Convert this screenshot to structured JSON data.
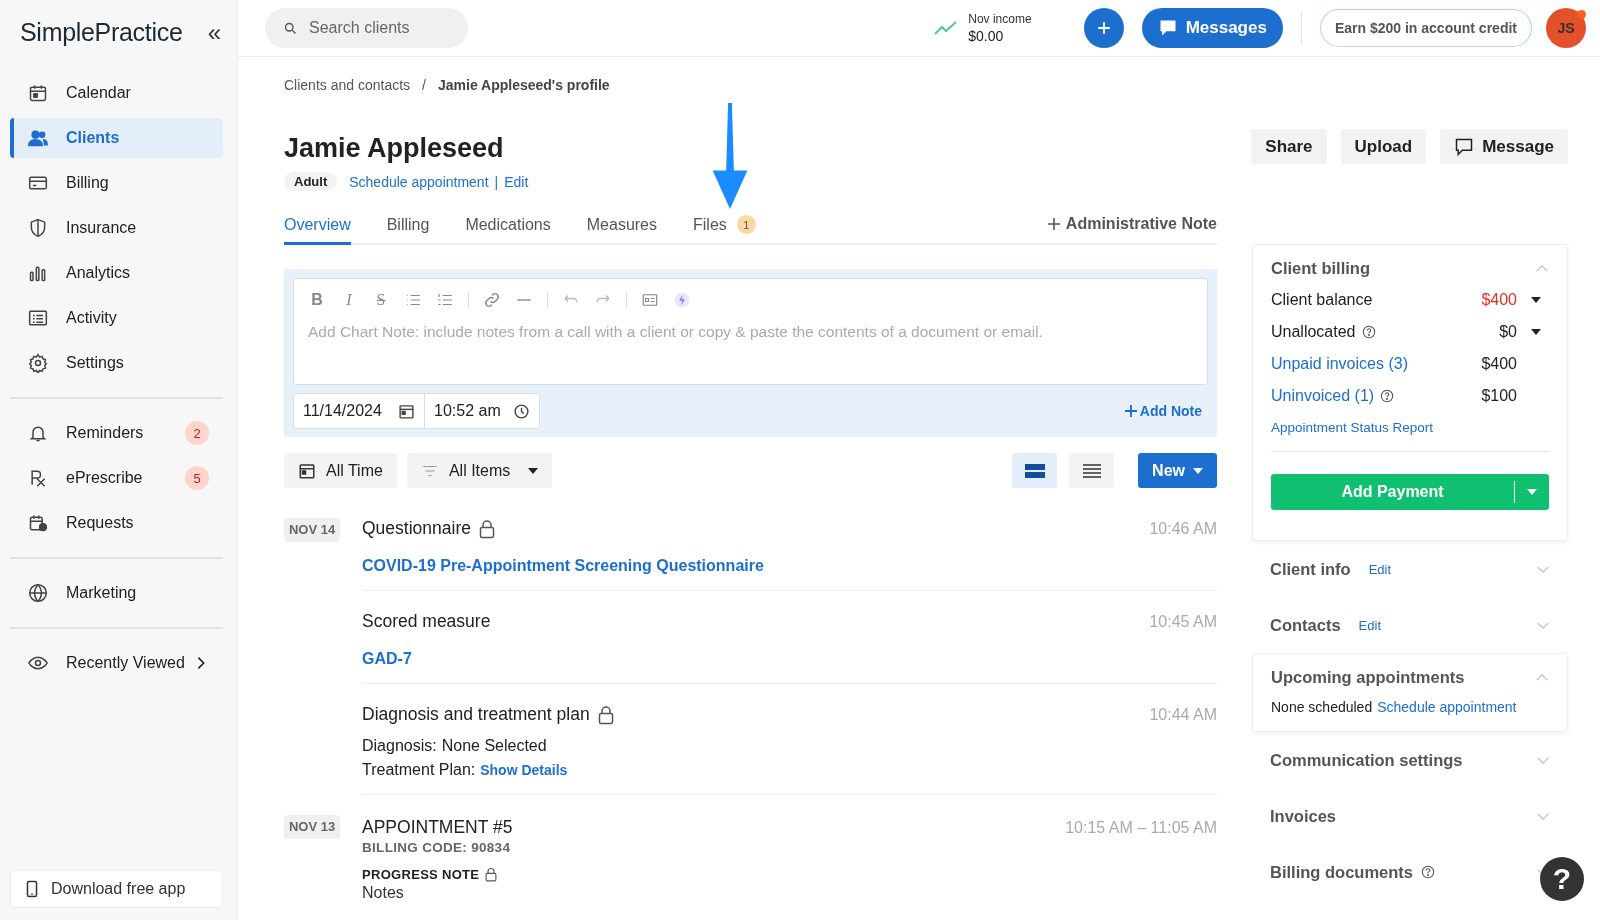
{
  "sidebar": {
    "logo": "SimplePractice",
    "collapse": "«",
    "groups": [
      {
        "items": [
          {
            "label": "Calendar",
            "selected": false
          },
          {
            "label": "Clients",
            "selected": true
          },
          {
            "label": "Billing",
            "selected": false
          },
          {
            "label": "Insurance",
            "selected": false
          },
          {
            "label": "Analytics",
            "selected": false
          },
          {
            "label": "Activity",
            "selected": false
          },
          {
            "label": "Settings",
            "selected": false
          }
        ]
      },
      {
        "items": [
          {
            "label": "Reminders",
            "selected": false,
            "badge": "2"
          },
          {
            "label": "ePrescribe",
            "selected": false,
            "badge": "5"
          },
          {
            "label": "Requests",
            "selected": false
          }
        ]
      },
      {
        "items": [
          {
            "label": "Marketing",
            "selected": false
          }
        ]
      },
      {
        "items": [
          {
            "label": "Recently Viewed",
            "selected": false,
            "chevron": true
          }
        ]
      }
    ],
    "download_app": "Download free app"
  },
  "topbar": {
    "search": {
      "placeholder": "Search clients"
    },
    "income_label": "Nov income",
    "income_value": "$0.00",
    "messages": "Messages",
    "credit": "Earn $200 in account credit",
    "avatar": "JS",
    "avatar_notification": true
  },
  "breadcrumb": {
    "items": [
      "Clients and contacts",
      "Jamie Appleseed's profile"
    ],
    "separator": "/"
  },
  "client": {
    "name": "Jamie Appleseed",
    "tag": "Adult",
    "links": [
      "Schedule appointment",
      "Edit"
    ],
    "separator": "|"
  },
  "actions": [
    {
      "label": "Share",
      "kind": "plain"
    },
    {
      "label": "Upload",
      "kind": "plain"
    },
    {
      "label": "Message",
      "kind": "icon"
    }
  ],
  "tabs": [
    {
      "label": "Overview",
      "selected": true
    },
    {
      "label": "Billing",
      "selected": false
    },
    {
      "label": "Medications",
      "selected": false
    },
    {
      "label": "Measures",
      "selected": false
    },
    {
      "label": "Files",
      "selected": false,
      "badge": "1"
    }
  ],
  "admin_note": "Administrative Note",
  "note_editor": {
    "format_buttons": [
      "B",
      "I",
      "S"
    ],
    "placeholder": "Add Chart Note: include notes from a call with a client or copy & paste the contents of a document or email.",
    "date": "11/14/2024",
    "time": "10:52 am",
    "add_note": "Add Note"
  },
  "filters": [
    "All Time",
    "All Items"
  ],
  "view_toggle": [
    {
      "selected": true
    },
    {
      "selected": false
    }
  ],
  "new_button": "New",
  "timeline": [
    {
      "date": "NOV 14",
      "entries": [
        {
          "kind": "questionnaire",
          "title": "Questionnaire",
          "locked": true,
          "time": "10:46 AM",
          "link": "COVID-19 Pre-Appointment Screening Questionnaire"
        },
        {
          "kind": "measure",
          "title": "Scored measure",
          "time": "10:45 AM",
          "link": "GAD-7"
        },
        {
          "kind": "diagnosis",
          "title": "Diagnosis and treatment plan",
          "locked": true,
          "time": "10:44 AM",
          "fields": [
            {
              "label": "Diagnosis:",
              "value": "None Selected"
            },
            {
              "label": "Treatment Plan:",
              "link": "Show Details"
            }
          ]
        }
      ]
    },
    {
      "date": "NOV 13",
      "entries": [
        {
          "kind": "appointment",
          "title": "APPOINTMENT #5",
          "time": "10:15 AM – 11:05 AM",
          "code": "BILLING CODE: 90834",
          "note_label": "PROGRESS NOTE",
          "note_locked": true,
          "note": "Notes"
        }
      ]
    }
  ],
  "panel": {
    "sections": [
      {
        "kind": "billing",
        "title": "Client billing",
        "expanded": true,
        "rows": [
          {
            "label": "Client balance",
            "value": "$400",
            "alert": true,
            "dropdown": true
          },
          {
            "label": "Unallocated",
            "value": "$0",
            "alert": false,
            "help": true,
            "dropdown": true
          },
          {
            "label": "Unpaid invoices (3)",
            "value": "$400",
            "alert": false,
            "link": true
          },
          {
            "label": "Uninvoiced (1)",
            "value": "$100",
            "alert": false,
            "link": true,
            "help": true
          }
        ],
        "report": "Appointment Status Report",
        "payment": "Add Payment"
      },
      {
        "kind": "plain",
        "title": "Client info",
        "expanded": false,
        "edit": "Edit"
      },
      {
        "kind": "plain",
        "title": "Contacts",
        "expanded": false,
        "edit": "Edit"
      },
      {
        "kind": "appointments",
        "title": "Upcoming appointments",
        "expanded": true,
        "empty": "None scheduled",
        "link": "Schedule appointment"
      },
      {
        "kind": "plain",
        "title": "Communication settings",
        "expanded": false
      },
      {
        "kind": "plain",
        "title": "Invoices",
        "expanded": false
      },
      {
        "kind": "plain",
        "title": "Billing documents",
        "expanded": false,
        "help": true
      }
    ]
  },
  "help_button": "?"
}
